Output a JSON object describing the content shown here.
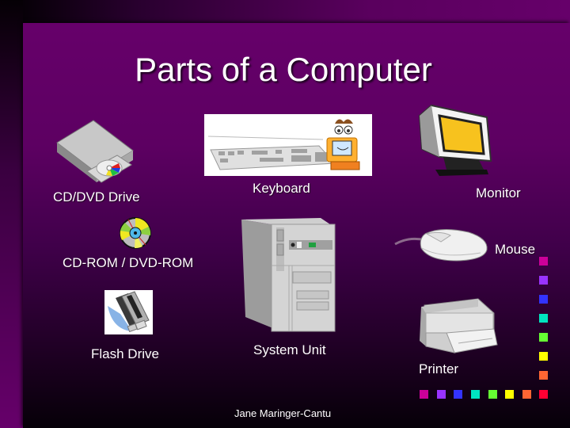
{
  "slide": {
    "title": "Parts of a Computer",
    "footer": "Jane Maringer-Cantu"
  },
  "items": [
    {
      "label": "CD/DVD Drive",
      "icon": "cd-dvd-drive-icon"
    },
    {
      "label": "Keyboard",
      "icon": "keyboard-icon"
    },
    {
      "label": "Monitor",
      "icon": "monitor-icon"
    },
    {
      "label": "Mouse",
      "icon": "mouse-icon"
    },
    {
      "label": "CD-ROM / DVD-ROM",
      "icon": "cd-rom-disc-icon"
    },
    {
      "label": "System Unit",
      "icon": "system-unit-icon"
    },
    {
      "label": "Flash Drive",
      "icon": "flash-drive-icon"
    },
    {
      "label": "Printer",
      "icon": "printer-icon"
    }
  ],
  "decor": {
    "square_colors": [
      "#cc0099",
      "#9933ff",
      "#3333ff",
      "#00e5c0",
      "#66ff33",
      "#ffff00",
      "#ff6633",
      "#ff0033"
    ]
  }
}
